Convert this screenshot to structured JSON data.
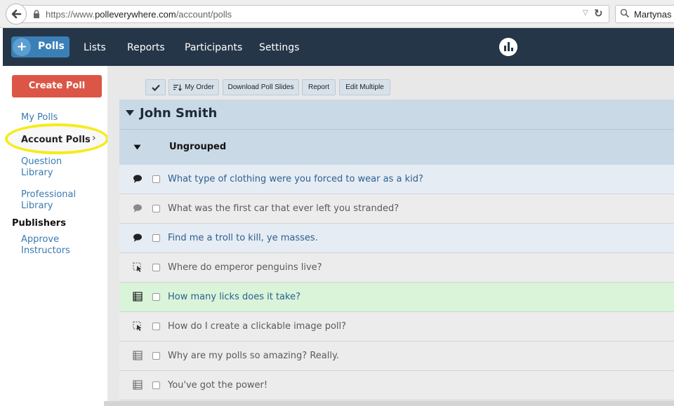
{
  "browser": {
    "url_prefix": "https://www.",
    "url_domain": "polleverywhere.com",
    "url_path": "/account/polls",
    "search_value": "Martynas K"
  },
  "nav": {
    "polls_label": "Polls",
    "links": [
      "Lists",
      "Reports",
      "Participants",
      "Settings"
    ]
  },
  "sidebar": {
    "create_label": "Create Poll",
    "my_polls": "My Polls",
    "account_polls": "Account Polls",
    "question_library": [
      "Question",
      "Library"
    ],
    "professional_library": [
      "Professional",
      "Library"
    ],
    "publishers_heading": "Publishers",
    "approve_instructors": [
      "Approve",
      "Instructors"
    ]
  },
  "toolbar": {
    "my_order": "My Order",
    "download": "Download Poll Slides",
    "report": "Report",
    "edit_multiple": "Edit Multiple"
  },
  "group": {
    "title": "John Smith",
    "subgroup": "Ungrouped"
  },
  "polls": [
    {
      "text": "What type of clothing were you forced to wear as a kid?",
      "icon": "comment-icon"
    },
    {
      "text": "What was the first car that ever left you stranded?",
      "icon": "comment-icon"
    },
    {
      "text": "Find me a troll to kill, ye masses.",
      "icon": "comment-icon"
    },
    {
      "text": "Where do emperor penguins live?",
      "icon": "clickable-image-icon"
    },
    {
      "text": "How many licks does it take?",
      "icon": "multiple-choice-icon"
    },
    {
      "text": "How do I create a clickable image poll?",
      "icon": "clickable-image-icon"
    },
    {
      "text": "Why are my polls so amazing? Really.",
      "icon": "multiple-choice-icon"
    },
    {
      "text": "You've got the power!",
      "icon": "multiple-choice-icon"
    }
  ],
  "colors": {
    "nav_bg": "#253648",
    "accent_blue": "#3a80b7",
    "create_red": "#db5646",
    "highlight_yellow": "#f6eb1a",
    "row_green": "#d9f4d9"
  }
}
